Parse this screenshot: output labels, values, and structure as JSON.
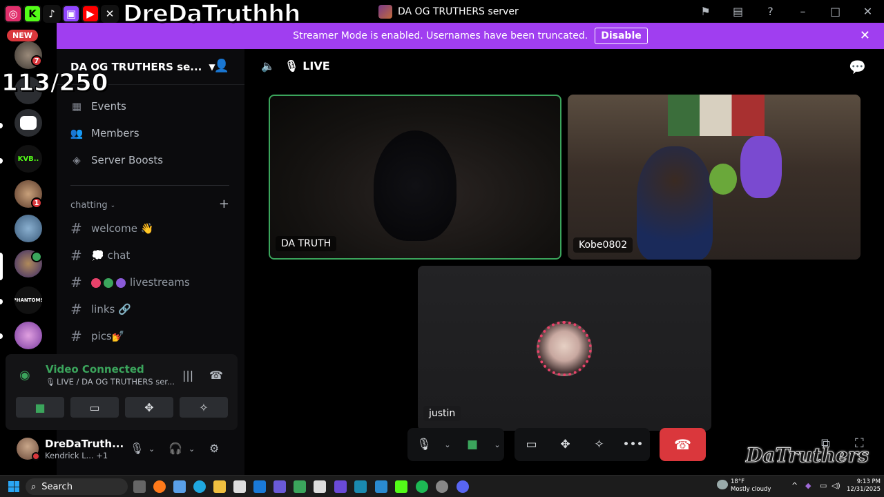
{
  "overlay": {
    "social_icons": [
      {
        "name": "instagram-icon",
        "glyph": "◎",
        "color": "#e1306c"
      },
      {
        "name": "kick-icon",
        "glyph": "K",
        "color": "#53fc18"
      },
      {
        "name": "tiktok-icon",
        "glyph": "♪",
        "color": "#111111"
      },
      {
        "name": "twitch-icon",
        "glyph": "▣",
        "color": "#9146ff"
      },
      {
        "name": "youtube-icon",
        "glyph": "▶",
        "color": "#ff0000"
      },
      {
        "name": "x-icon",
        "glyph": "✕",
        "color": "#111111"
      }
    ],
    "handle": "DreDaTruthhh",
    "counter": "113/250",
    "watermark": "DaTruthers"
  },
  "window": {
    "title": "DA OG TRUTHERS server"
  },
  "banner": {
    "text": "Streamer Mode is enabled. Usernames have been truncated.",
    "disable_label": "Disable"
  },
  "rail": {
    "new_label": "NEW",
    "servers": [
      {
        "name": "server-1",
        "badge": "7"
      },
      {
        "name": "server-2",
        "badge": ""
      },
      {
        "name": "server-3",
        "badge": ""
      },
      {
        "name": "server-kvb",
        "text": "KVB.."
      },
      {
        "name": "server-5",
        "badge": "1"
      },
      {
        "name": "server-6",
        "badge": ""
      },
      {
        "name": "server-7",
        "badge": ""
      },
      {
        "name": "server-phantoms",
        "text": "PHANTOMS"
      },
      {
        "name": "server-9",
        "badge": ""
      }
    ]
  },
  "sidebar": {
    "server_name": "DA OG TRUTHERS se...",
    "nav": [
      {
        "label": "Events",
        "icon": "calendar-icon"
      },
      {
        "label": "Members",
        "icon": "members-icon"
      },
      {
        "label": "Server Boosts",
        "icon": "boost-icon"
      }
    ],
    "category": "chatting",
    "channels": [
      {
        "label": "welcome 👋"
      },
      {
        "label": "💭 chat"
      },
      {
        "label": "livestreams"
      },
      {
        "label": "links 🔗"
      },
      {
        "label": "pics💅"
      }
    ]
  },
  "voice": {
    "status": "Video Connected",
    "location": "LIVE / DA OG TRUTHERS ser..."
  },
  "user": {
    "name": "DreDaTruth...",
    "activity": "Kendrick L... +1"
  },
  "stage": {
    "channel_name": "LIVE",
    "tiles": [
      {
        "label": "DA TRUTH"
      },
      {
        "label": "Kobe0802"
      },
      {
        "label": "justin"
      }
    ]
  },
  "taskbar": {
    "search_placeholder": "Search",
    "weather_temp": "18°F",
    "weather_desc": "Mostly cloudy",
    "time": "9:13 PM",
    "date": "12/31/2025"
  },
  "colors": {
    "accent": "#a03ef0",
    "connected": "#3ba55c",
    "danger": "#da373c",
    "speaking_border": "#3ba55c"
  }
}
